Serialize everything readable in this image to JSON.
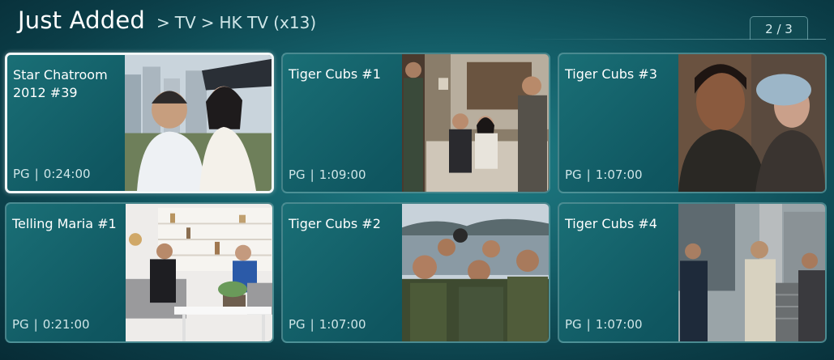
{
  "header": {
    "title": "Just Added",
    "breadcrumb": [
      "TV",
      "HK TV (x13)"
    ],
    "separator": ">"
  },
  "pager": {
    "label": "2 / 3"
  },
  "tiles": [
    {
      "title": "Star Chatroom 2012 #39",
      "rating": "PG",
      "duration": "0:24:00",
      "selected": true
    },
    {
      "title": "Tiger Cubs #1",
      "rating": "PG",
      "duration": "1:09:00",
      "selected": false
    },
    {
      "title": "Tiger Cubs #3",
      "rating": "PG",
      "duration": "1:07:00",
      "selected": false
    },
    {
      "title": "Telling Maria #1",
      "rating": "PG",
      "duration": "0:21:00",
      "selected": false
    },
    {
      "title": "Tiger Cubs #2",
      "rating": "PG",
      "duration": "1:07:00",
      "selected": false
    },
    {
      "title": "Tiger Cubs #4",
      "rating": "PG",
      "duration": "1:07:00",
      "selected": false
    }
  ]
}
